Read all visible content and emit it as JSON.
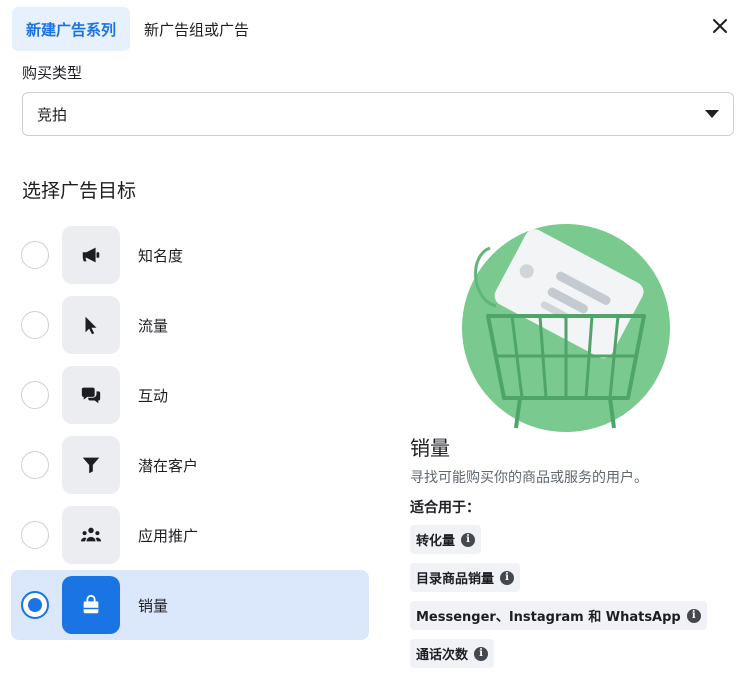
{
  "tabs": [
    {
      "label": "新建广告系列",
      "active": true
    },
    {
      "label": "新广告组或广告",
      "active": false
    }
  ],
  "buy_type": {
    "label": "购买类型",
    "value": "竞拍"
  },
  "section_title": "选择广告目标",
  "objectives": [
    {
      "label": "知名度",
      "icon": "megaphone-icon",
      "selected": false
    },
    {
      "label": "流量",
      "icon": "cursor-icon",
      "selected": false
    },
    {
      "label": "互动",
      "icon": "chat-bubbles-icon",
      "selected": false
    },
    {
      "label": "潜在客户",
      "icon": "funnel-icon",
      "selected": false
    },
    {
      "label": "应用推广",
      "icon": "people-icon",
      "selected": false
    },
    {
      "label": "销量",
      "icon": "shopping-bag-icon",
      "selected": true
    }
  ],
  "detail": {
    "title": "销量",
    "description": "寻找可能购买你的商品或服务的用户。",
    "suitable_label": "适合用于：",
    "chips": [
      "转化量",
      "目录商品销量",
      "Messenger、Instagram 和 WhatsApp",
      "通话次数"
    ]
  },
  "colors": {
    "accent": "#1b74e4",
    "selected_bg": "#dbe7fb",
    "illustration_green": "#7ac98f"
  }
}
